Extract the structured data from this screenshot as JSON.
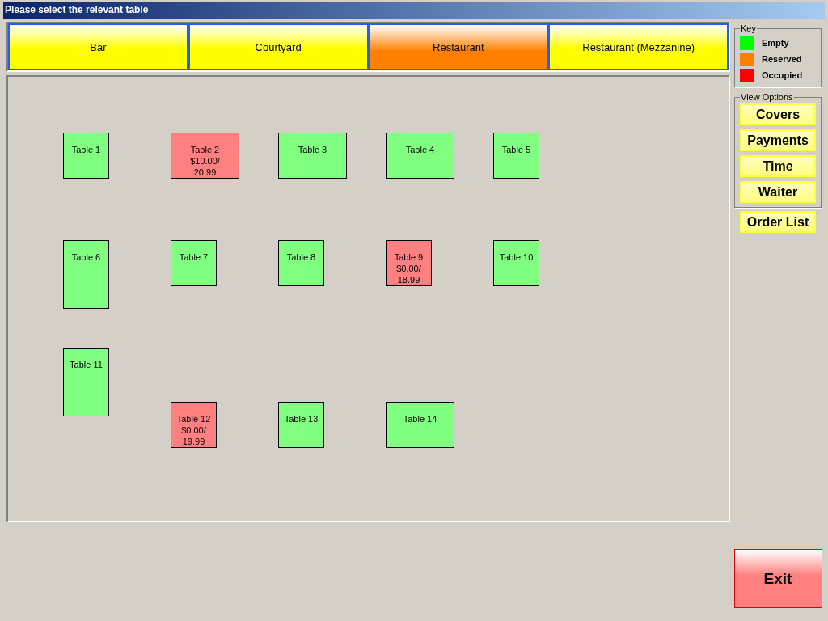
{
  "window": {
    "title": "Please select the relevant table"
  },
  "tabs": [
    {
      "label": "Bar",
      "selected": false
    },
    {
      "label": "Courtyard",
      "selected": false
    },
    {
      "label": "Restaurant",
      "selected": true
    },
    {
      "label": "Restaurant (Mezzanine)",
      "selected": false
    }
  ],
  "tables": [
    {
      "label": "Table 1",
      "color": "#80ff80"
    },
    {
      "label": "Table 2",
      "color": "#ff8080",
      "amount": [
        "$10.00/",
        "20.99"
      ]
    },
    {
      "label": "Table 3",
      "color": "#80ff80"
    },
    {
      "label": "Table 4",
      "color": "#80ff80"
    },
    {
      "label": "Table 5",
      "color": "#80ff80"
    },
    {
      "label": "Table 6",
      "color": "#80ff80"
    },
    {
      "label": "Table 7",
      "color": "#80ff80"
    },
    {
      "label": "Table 8",
      "color": "#80ff80"
    },
    {
      "label": "Table 9",
      "color": "#ff8080",
      "amount": [
        "$0.00/",
        "18.99"
      ]
    },
    {
      "label": "Table 10",
      "color": "#80ff80"
    },
    {
      "label": "Table 11",
      "color": "#80ff80"
    },
    {
      "label": "Table 12",
      "color": "#ff8080",
      "amount": [
        "$0.00/",
        "19.99"
      ]
    },
    {
      "label": "Table 13",
      "color": "#80ff80"
    },
    {
      "label": "Table 14",
      "color": "#80ff80"
    }
  ],
  "key": {
    "title": "Key",
    "items": [
      {
        "label": "Empty",
        "color": "#00ff00"
      },
      {
        "label": "Reserved",
        "color": "#ff8000"
      },
      {
        "label": "Occupied",
        "color": "#ff0000"
      }
    ]
  },
  "view_options": {
    "title": "View Options",
    "buttons": [
      "Covers",
      "Payments",
      "Time",
      "Waiter"
    ]
  },
  "order_list_button": "Order List",
  "exit_button": "Exit"
}
